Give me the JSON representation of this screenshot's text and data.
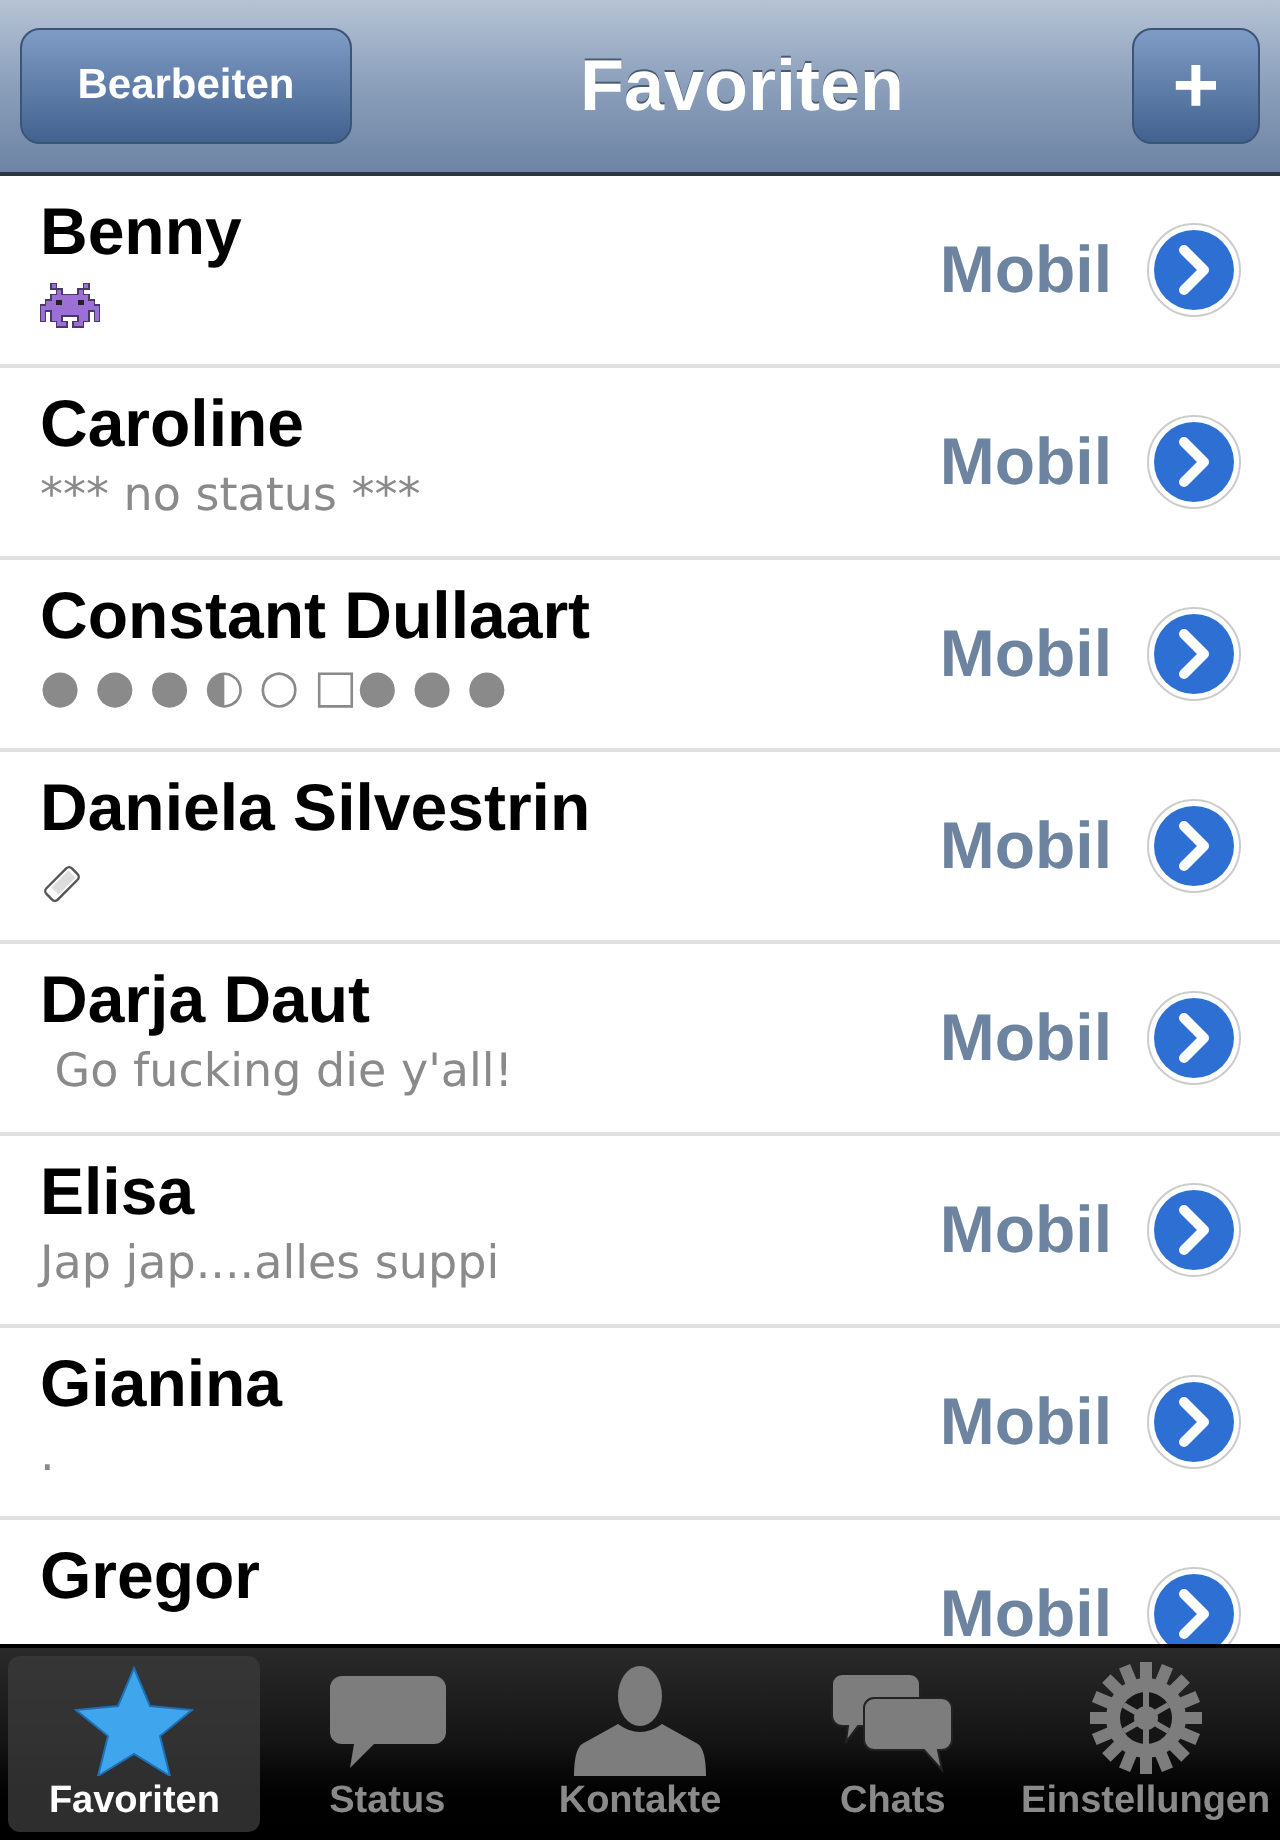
{
  "nav_bar": {
    "title": "Favoriten",
    "edit_button": "Bearbeiten",
    "add_button": "+"
  },
  "contacts": [
    {
      "name": "Benny",
      "kind": "alien",
      "label": "Mobil"
    },
    {
      "name": "Caroline",
      "kind": "text",
      "status": "*** no status ***",
      "label": "Mobil"
    },
    {
      "name": "Constant Dullaart",
      "kind": "text",
      "status": "● ● ● ◐ ○ □● ● ●",
      "label": "Mobil"
    },
    {
      "name": "Daniela Silvestrin",
      "kind": "phone",
      "label": "Mobil"
    },
    {
      "name": "Darja Daut",
      "kind": "text",
      "status": " Go fucking die y'all!",
      "label": "Mobil"
    },
    {
      "name": "Elisa",
      "kind": "text",
      "status": "Jap jap....alles suppi",
      "label": "Mobil"
    },
    {
      "name": "Gianina",
      "kind": "text",
      "status": ".",
      "label": "Mobil"
    },
    {
      "name": "Gregor",
      "label": "Mobil"
    }
  ],
  "tab_bar": [
    {
      "label": "Favoriten",
      "kind": "star",
      "selected": true
    },
    {
      "label": "Status",
      "kind": "bubble",
      "selected": false
    },
    {
      "label": "Kontakte",
      "kind": "person",
      "selected": false
    },
    {
      "label": "Chats",
      "kind": "bubbles",
      "selected": false
    },
    {
      "label": "Einstellungen",
      "kind": "gear",
      "selected": false
    }
  ]
}
